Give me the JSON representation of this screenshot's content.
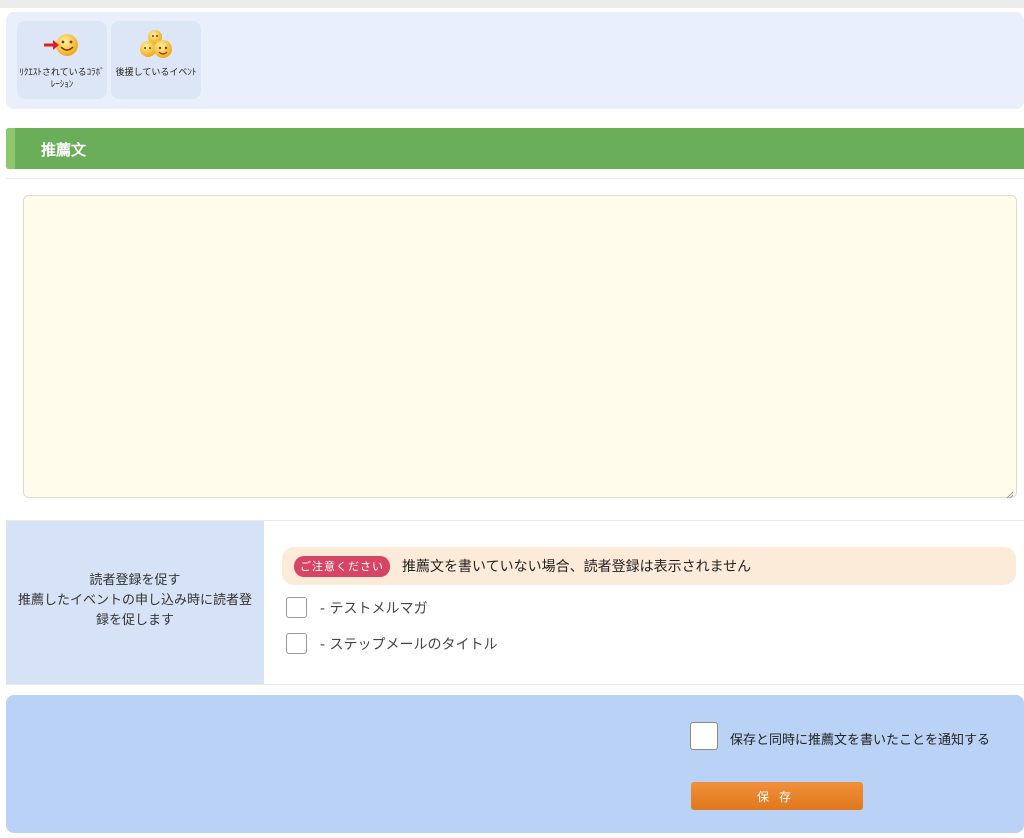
{
  "icon_panel": {
    "tiles": [
      {
        "label": "ﾘｸｴｽﾄされているｺﾗﾎﾞﾚｰｼｮﾝ",
        "icon": "smile-arrow-icon"
      },
      {
        "label": "後援しているイベﾝﾄ",
        "icon": "group-smile-icon"
      }
    ]
  },
  "section": {
    "title": "推薦文"
  },
  "recommendation": {
    "text": ""
  },
  "reader_registration": {
    "label": "読者登録を促す\n推薦したイベントの申し込み時に読者登録を促します",
    "label_line1": "読者登録を促す",
    "label_line2": "推薦したイベントの申し込み時に読者登録を促します",
    "notice_badge": "ご注意ください",
    "notice_message": "推薦文を書いていない場合、読者登録は表示されません",
    "options": [
      {
        "label": "- テストメルマガ",
        "checked": false
      },
      {
        "label": "- ステップメールのタイトル",
        "checked": false
      }
    ]
  },
  "footer": {
    "notify_label": "保存と同時に推薦文を書いたことを通知する",
    "notify_checked": false,
    "save_label": "保存"
  },
  "colors": {
    "section_green": "#6aae5a",
    "footer_blue": "#b9d2f5",
    "save_orange": "#e8832a",
    "badge_pink": "#d64466"
  }
}
